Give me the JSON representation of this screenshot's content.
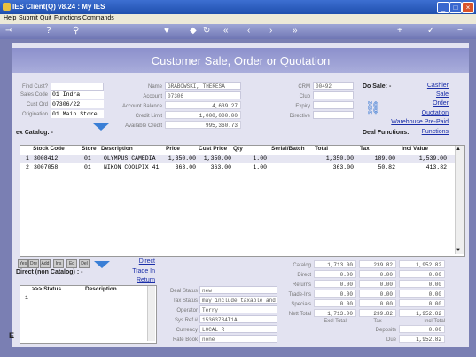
{
  "window": {
    "title": "IES Client(Q) v8.24 : My IES"
  },
  "menu": [
    "Help",
    "Submit",
    "Quit",
    "Functions",
    "Commands"
  ],
  "header": {
    "title": "Customer Sale, Order or Quotation"
  },
  "customer": {
    "find_cust_label": "Find Cust?",
    "sales_code_label": "Sales Code",
    "sales_code": "01 Indra",
    "cust_ord_label": "Cust Ord",
    "cust_ord": "07306/22",
    "origination_label": "Origination",
    "origination": "01 Main Store",
    "name_label": "Name",
    "name": "GRABOWSKI, THERESA",
    "account_label": "Account",
    "account": "07306",
    "account_balance_label": "Account Balance",
    "account_balance": "4,639.27",
    "credit_limit_label": "Credit Limit",
    "credit_limit": "1,000,000.00",
    "available_credit_label": "Available Credit",
    "available_credit": "995,360.73",
    "crm_label": "CRM",
    "crm": "00492",
    "club_label": "Club",
    "expiry_label": "Expiry",
    "directive_label": "Directive"
  },
  "do_sale": {
    "label": "Do Sale: -",
    "links": [
      "Cashier",
      "Sale",
      "Order",
      "Quotation",
      "Warehouse Pre-Paid",
      "Functions"
    ]
  },
  "deal_functions_label": "Deal Functions:",
  "ex_catalog_label": "ex Catalog: -",
  "catalog_table": {
    "columns": [
      "Stock Code",
      "Store",
      "Description",
      "Price",
      "Cust Price",
      "Qty",
      "Serial/Batch",
      "Total",
      "Tax",
      "Incl Value"
    ],
    "rows": [
      {
        "num": "1",
        "stock_code": "3008412",
        "store": "01",
        "description": "OLYMPUS CAMEDIA",
        "price": "1,350.00",
        "cust_price": "1,350.00",
        "qty": "1.00",
        "serial": "",
        "total": "1,350.00",
        "tax": "189.00",
        "incl": "1,539.00"
      },
      {
        "num": "2",
        "stock_code": "3007058",
        "store": "01",
        "description": "NIKON COOLPIX 41",
        "price": "363.00",
        "cust_price": "363.00",
        "qty": "1.00",
        "serial": "",
        "total": "363.00",
        "tax": "50.82",
        "incl": "413.82"
      }
    ]
  },
  "mini_tabs": [
    "Yes",
    "Dre",
    "Add",
    "Ins",
    "Ed",
    "Del"
  ],
  "direct_links": [
    "Direct",
    "Trade In",
    "Return"
  ],
  "non_catalog_label": "Direct (non Catalog) : -",
  "non_catalog_table": {
    "columns": [
      ">>> Status",
      "Description"
    ],
    "rows": [
      {
        "num": "1"
      }
    ]
  },
  "deal_info": {
    "deal_status_label": "Deal Status",
    "deal_status": "new",
    "tax_status_label": "Tax Status",
    "tax_status": "may include taxable and",
    "operator_label": "Operator",
    "operator": "Terry",
    "sys_ref_label": "Sys Ref #",
    "sys_ref": "15363784T1A",
    "currency_label": "Currency",
    "currency": "LOCAL R",
    "rate_book_label": "Rate Book",
    "rate_book": "none"
  },
  "totals": {
    "rows": [
      {
        "label": "Catalog",
        "excl": "1,713.00",
        "tax": "239.82",
        "incl": "1,952.82"
      },
      {
        "label": "Direct",
        "excl": "0.00",
        "tax": "0.00",
        "incl": "0.00"
      },
      {
        "label": "Returns",
        "excl": "0.00",
        "tax": "0.00",
        "incl": "0.00"
      },
      {
        "label": "Trade-Ins",
        "excl": "0.00",
        "tax": "0.00",
        "incl": "0.00"
      },
      {
        "label": "Specials",
        "excl": "0.00",
        "tax": "0.00",
        "incl": "0.00"
      },
      {
        "label": "Nett Total",
        "excl": "1,713.00",
        "tax": "239.82",
        "incl": "1,952.82"
      }
    ],
    "excl_total_label": "Excl Total",
    "tax_label": "Tax",
    "incl_total_label": "Incl Total",
    "deposits_label": "Deposits",
    "deposits": "0.00",
    "due_label": "Due",
    "due": "1,952.82"
  },
  "colors": {
    "title_bar": "#2a5bc0",
    "header": "#9a9ed4",
    "panel": "#e3e3f1",
    "link": "#1a2ea8"
  }
}
